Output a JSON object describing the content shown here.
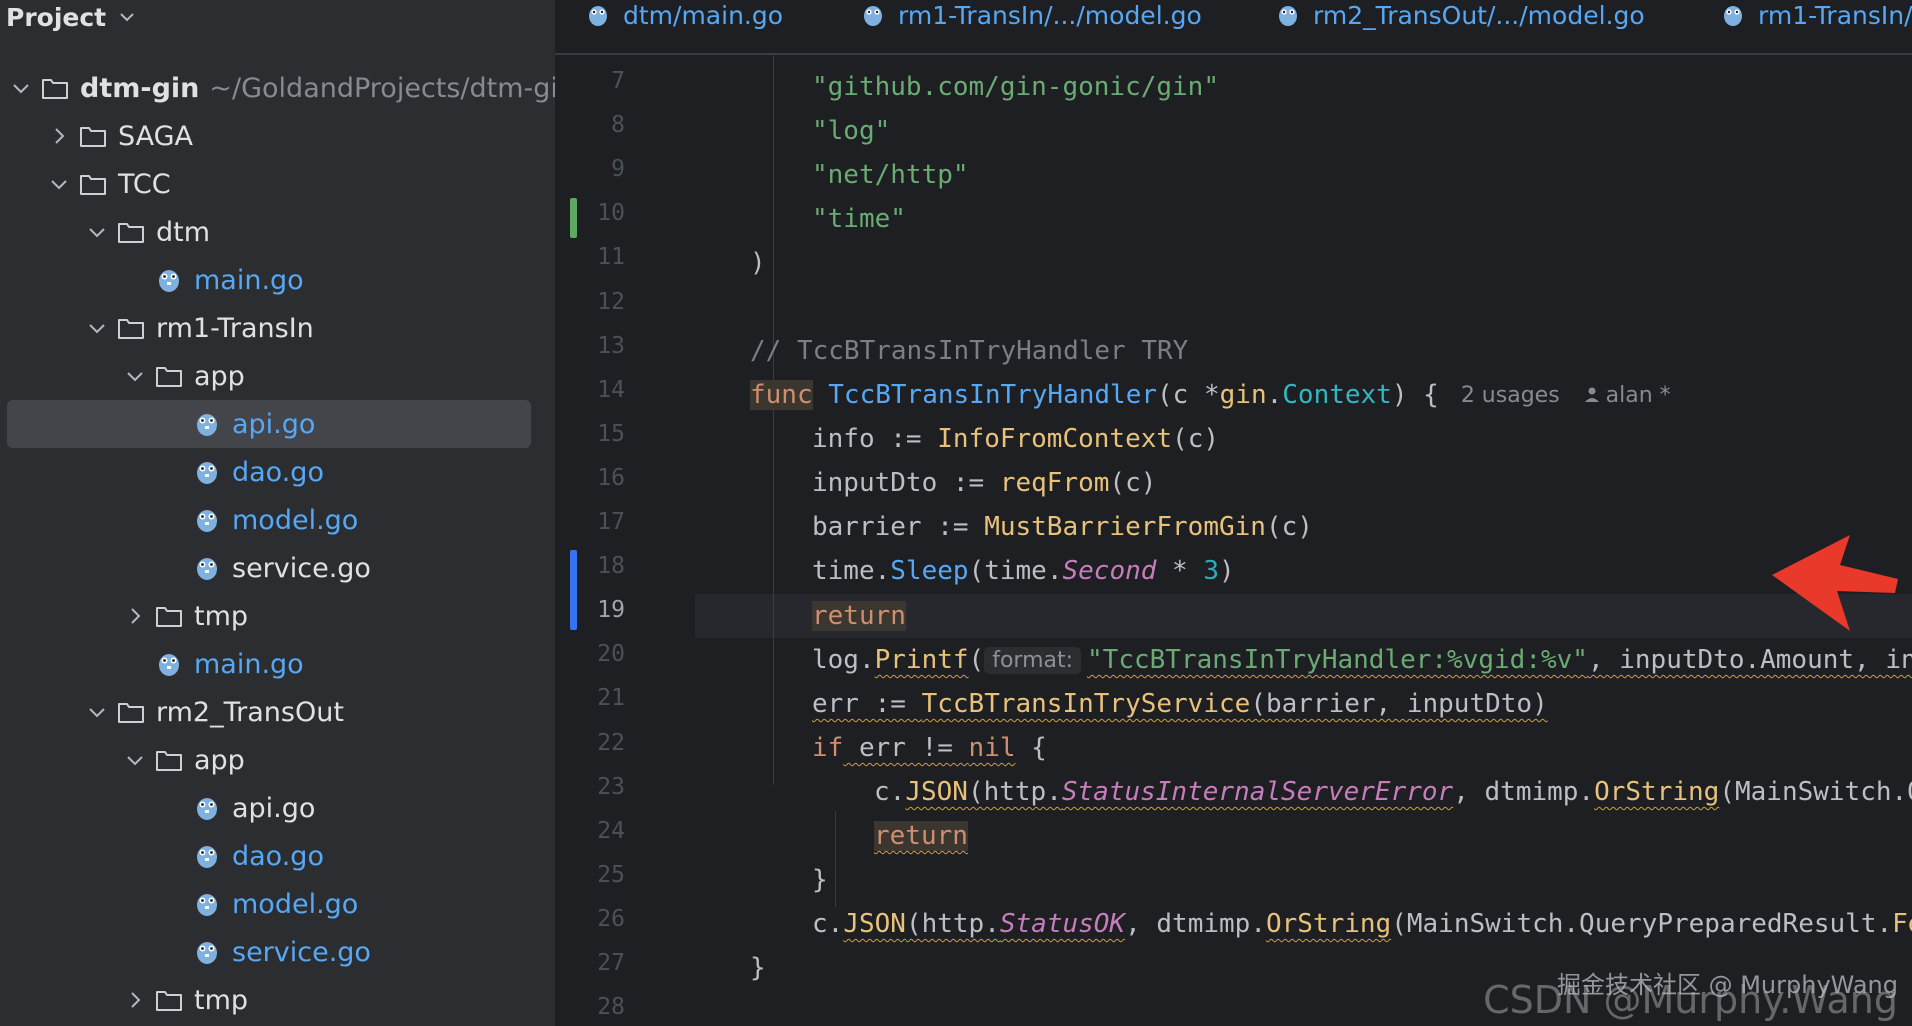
{
  "colors": {
    "sidebar_bg": "#2b2d30",
    "editor_bg": "#1e1f22",
    "go_blue": "#56a8f5",
    "string": "#6aab73",
    "keyword": "#cf8e6d",
    "vcs_added": "#5fa860",
    "vcs_modified": "#3574f0",
    "arrow": "#e8392b"
  },
  "sidebar": {
    "header": {
      "title": "Project"
    },
    "tree": [
      {
        "label": "dtm-gin",
        "path": "~/GoldandProjects/dtm-gin",
        "kind": "folder",
        "level": 0,
        "expanded": true
      },
      {
        "label": "SAGA",
        "kind": "folder",
        "level": 1,
        "expanded": false
      },
      {
        "label": "TCC",
        "kind": "folder",
        "level": 1,
        "expanded": true
      },
      {
        "label": "dtm",
        "kind": "folder",
        "level": 2,
        "expanded": true
      },
      {
        "label": "main.go",
        "kind": "gofile",
        "level": 3,
        "blue": true
      },
      {
        "label": "rm1-TransIn",
        "kind": "folder",
        "level": 2,
        "expanded": true
      },
      {
        "label": "app",
        "kind": "folder",
        "level": 3,
        "expanded": true
      },
      {
        "label": "api.go",
        "kind": "gofile",
        "level": 4,
        "blue": true,
        "selected": true
      },
      {
        "label": "dao.go",
        "kind": "gofile",
        "level": 4,
        "blue": true
      },
      {
        "label": "model.go",
        "kind": "gofile",
        "level": 4,
        "blue": true
      },
      {
        "label": "service.go",
        "kind": "gofile",
        "level": 4,
        "blue": false
      },
      {
        "label": "tmp",
        "kind": "folder",
        "level": 3,
        "expanded": false
      },
      {
        "label": "main.go",
        "kind": "gofile",
        "level": 3,
        "blue": true
      },
      {
        "label": "rm2_TransOut",
        "kind": "folder",
        "level": 2,
        "expanded": true
      },
      {
        "label": "app",
        "kind": "folder",
        "level": 3,
        "expanded": true
      },
      {
        "label": "api.go",
        "kind": "gofile",
        "level": 4,
        "blue": false
      },
      {
        "label": "dao.go",
        "kind": "gofile",
        "level": 4,
        "blue": true
      },
      {
        "label": "model.go",
        "kind": "gofile",
        "level": 4,
        "blue": true
      },
      {
        "label": "service.go",
        "kind": "gofile",
        "level": 4,
        "blue": true
      },
      {
        "label": "tmp",
        "kind": "folder",
        "level": 3,
        "expanded": false
      }
    ]
  },
  "editor": {
    "tabs": [
      {
        "label": "dtm/main.go"
      },
      {
        "label": "rm1-TransIn/.../model.go"
      },
      {
        "label": "rm2_TransOut/.../model.go"
      },
      {
        "label": "rm1-TransIn/"
      }
    ],
    "line_numbers": [
      "7",
      "8",
      "9",
      "10",
      "11",
      "12",
      "13",
      "14",
      "15",
      "16",
      "17",
      "18",
      "19",
      "20",
      "21",
      "22",
      "23",
      "24",
      "25",
      "26",
      "27",
      "28"
    ],
    "current_line": "19",
    "hints": {
      "usages": "2 usages",
      "author": "alan *",
      "param_name": "format:"
    },
    "code": {
      "l7": "\"github.com/gin-gonic/gin\"",
      "l8": "\"log\"",
      "l9": "\"net/http\"",
      "l10": "\"time\"",
      "l11": ")",
      "l13_comment": "// TccBTransInTryHandler TRY",
      "l14": {
        "kw": "func",
        "name": "TccBTransInTryHandler",
        "open": "(c *",
        "pkg": "gin",
        "dot": ".",
        "typ": "Context",
        "close": ") {"
      },
      "l15": {
        "var": "info := ",
        "fn": "InfoFromContext",
        "args": "(c)"
      },
      "l16": {
        "var": "inputDto := ",
        "fn": "reqFrom",
        "args": "(c)"
      },
      "l17": {
        "var": "barrier := ",
        "fn": "MustBarrierFromGin",
        "args": "(c)"
      },
      "l18": {
        "a": "time.",
        "fn": "Sleep",
        "b": "(time.",
        "it": "Second",
        "c": " * ",
        "num": "3",
        "d": ")"
      },
      "l19": "return",
      "l20": {
        "a": "log.",
        "fn": "Printf",
        "b": "(",
        "str": "\"TccBTransInTryHandler:%vgid:%v\"",
        "c": ", inputDto.Amount, info."
      },
      "l21": {
        "a": "err := ",
        "fn": "TccBTransInTryService",
        "b": "(barrier, inputDto)"
      },
      "l22": {
        "kw": "if",
        "a": " err != ",
        "nil": "nil",
        "b": " {"
      },
      "l23": {
        "a": "c.",
        "fn": "JSON",
        "b": "(http.",
        "it": "StatusInternalServerError",
        "c": ", dtmimp.",
        "fn2": "OrString",
        "d": "(MainSwitch.Quer"
      },
      "l24": "return",
      "l25": "}",
      "l26": {
        "a": "c.",
        "fn": "JSON",
        "b": "(http.",
        "it": "StatusOK",
        "c": ", dtmimp.",
        "fn2": "OrString",
        "d": "(MainSwitch.QueryPreparedResult.",
        "fn3": "Fetch"
      },
      "l27": "}"
    }
  },
  "watermark": {
    "line1": "掘金技术社区 @ MurphyWang",
    "line2": "CSDN @Murphy.Wang"
  }
}
